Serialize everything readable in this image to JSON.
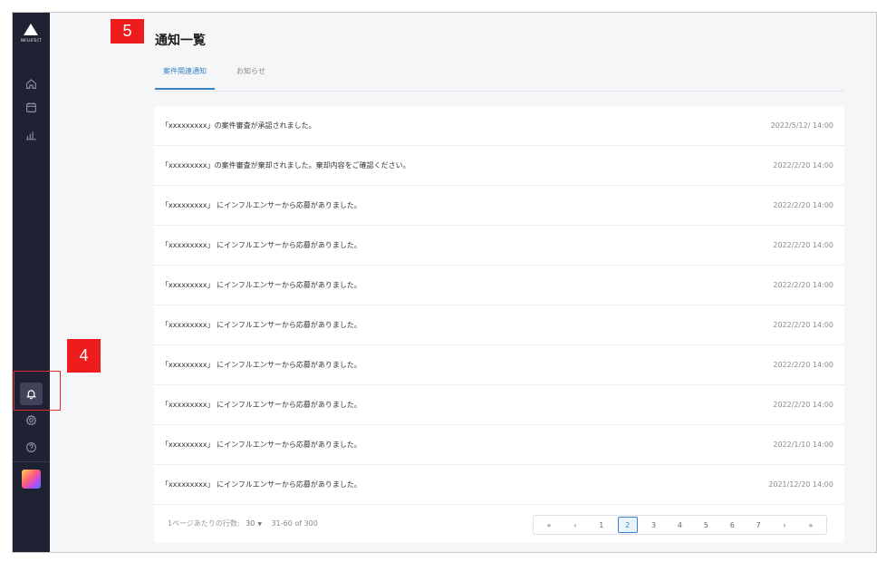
{
  "app": {
    "logo_text": "INFLUFECT"
  },
  "sidebar": {
    "items": [
      {
        "key": "home",
        "icon": "home-icon"
      },
      {
        "key": "calendar",
        "icon": "calendar-icon"
      },
      {
        "key": "analytics",
        "icon": "bar-chart-icon"
      },
      {
        "key": "notifications",
        "icon": "bell-icon",
        "active": true
      },
      {
        "key": "settings",
        "icon": "gear-icon"
      },
      {
        "key": "help",
        "icon": "help-icon"
      },
      {
        "key": "account",
        "icon": "gradient-avatar-icon"
      }
    ]
  },
  "page": {
    "title": "通知一覧"
  },
  "tabs": [
    {
      "label": "案件関連通知",
      "active": true
    },
    {
      "label": "お知らせ",
      "active": false
    }
  ],
  "notifications": [
    {
      "message": "「xxxxxxxxx」の案件審査が承認されました。",
      "date": "2022/5/12/ 14:00"
    },
    {
      "message": "「xxxxxxxxx」の案件審査が棄却されました。棄却内容をご確認ください。",
      "date": "2022/2/20 14:00"
    },
    {
      "message": "「xxxxxxxxx」 にインフルエンサーから応募がありました。",
      "date": "2022/2/20 14:00"
    },
    {
      "message": "「xxxxxxxxx」 にインフルエンサーから応募がありました。",
      "date": "2022/2/20 14:00"
    },
    {
      "message": "「xxxxxxxxx」 にインフルエンサーから応募がありました。",
      "date": "2022/2/20 14:00"
    },
    {
      "message": "「xxxxxxxxx」 にインフルエンサーから応募がありました。",
      "date": "2022/2/20 14:00"
    },
    {
      "message": "「xxxxxxxxx」 にインフルエンサーから応募がありました。",
      "date": "2022/2/20 14:00"
    },
    {
      "message": "「xxxxxxxxx」 にインフルエンサーから応募がありました。",
      "date": "2022/2/20 14:00"
    },
    {
      "message": "「xxxxxxxxx」 にインフルエンサーから応募がありました。",
      "date": "2022/1/10 14:00"
    },
    {
      "message": "「xxxxxxxxx」 にインフルエンサーから応募がありました。",
      "date": "2021/12/20 14:00"
    }
  ],
  "pagination": {
    "rows_per_page_label": "1ページあたりの行数:",
    "rows_per_page_value": "30",
    "range_text": "31-60 of 300",
    "first_label": "«",
    "prev_label": "‹",
    "next_label": "›",
    "last_label": "»",
    "pages": [
      "1",
      "2",
      "3",
      "4",
      "5",
      "6",
      "7"
    ],
    "current_page": "2"
  },
  "annotations": {
    "marker_4": "4",
    "marker_5": "5"
  },
  "colors": {
    "sidebar_bg": "#1f2233",
    "accent": "#3b82c4",
    "annotation_red": "#ee1c1c"
  }
}
